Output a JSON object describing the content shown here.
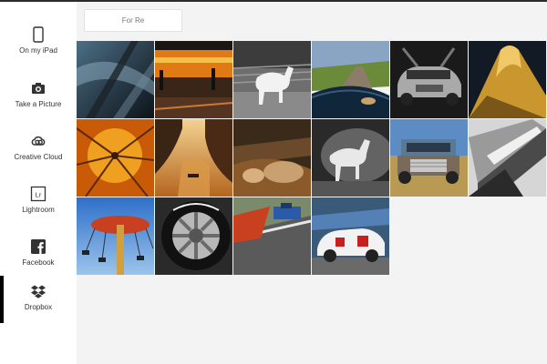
{
  "sidebar": {
    "items": [
      {
        "label": "On my iPad",
        "icon": "ipad-icon"
      },
      {
        "label": "Take a Picture",
        "icon": "camera-icon"
      },
      {
        "label": "Creative Cloud",
        "icon": "creative-cloud-icon"
      },
      {
        "label": "Lightroom",
        "icon": "lightroom-icon"
      },
      {
        "label": "Facebook",
        "icon": "facebook-icon"
      },
      {
        "label": "Dropbox",
        "icon": "dropbox-icon",
        "active": true
      }
    ]
  },
  "search": {
    "value": "For Re"
  },
  "photos": [
    {
      "name": "photo-car-windshield-abstract"
    },
    {
      "name": "photo-train-platform-orange"
    },
    {
      "name": "photo-white-horse-corral"
    },
    {
      "name": "photo-country-road-hood"
    },
    {
      "name": "photo-mercedes-gullwing-bw"
    },
    {
      "name": "photo-golden-metal-curve"
    },
    {
      "name": "photo-orange-umbrella"
    },
    {
      "name": "photo-golden-river-boat"
    },
    {
      "name": "photo-dog-paw-blanket"
    },
    {
      "name": "photo-horse-dust-bw"
    },
    {
      "name": "photo-old-truck-field"
    },
    {
      "name": "photo-knife-blade-bw"
    },
    {
      "name": "photo-swing-carousel"
    },
    {
      "name": "photo-michelin-wheel"
    },
    {
      "name": "photo-race-car-curve"
    },
    {
      "name": "photo-porsche-racing-blur"
    }
  ]
}
